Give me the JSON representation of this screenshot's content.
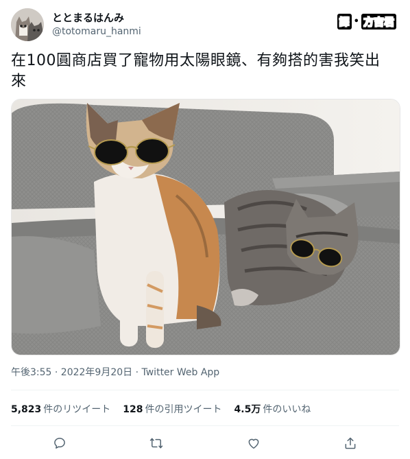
{
  "author": {
    "display_name": "ととまるはんみ",
    "handle": "@totomaru_hanmi"
  },
  "credit": {
    "label": "譯",
    "separator": "•",
    "translator": "方吉君"
  },
  "tweet": {
    "text": "在100圓商店買了寵物用太陽眼鏡、有夠搭的害我笑出來",
    "timestamp": "午後3:55 · 2022年9月20日",
    "source": "Twitter Web App"
  },
  "stats": [
    {
      "count": "5,823",
      "label": "件のリツイート"
    },
    {
      "count": "128",
      "label": "件の引用ツイート"
    },
    {
      "count": "4.5万",
      "label": "件のいいね"
    }
  ],
  "actions": [
    "reply-icon",
    "retweet-icon",
    "like-icon",
    "share-icon"
  ],
  "colors": {
    "text": "#0f1419",
    "secondary": "#536471",
    "divider": "#eff3f4"
  }
}
